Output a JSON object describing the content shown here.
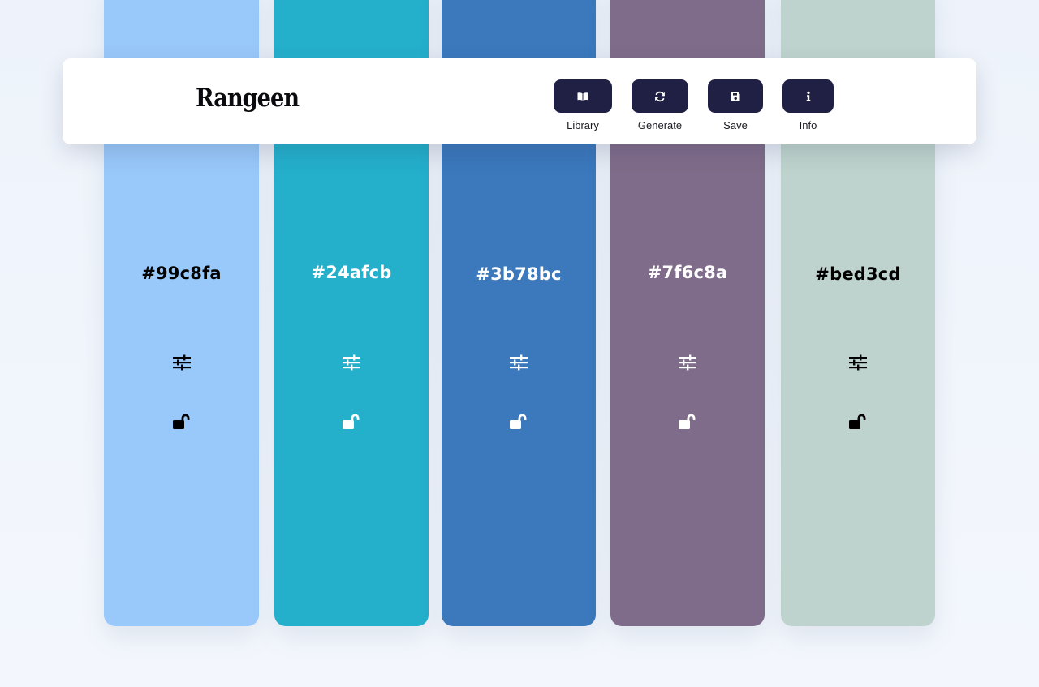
{
  "app": {
    "logo_text": "Rangeen"
  },
  "toolbar": {
    "library_label": "Library",
    "generate_label": "Generate",
    "save_label": "Save",
    "info_label": "Info",
    "button_color": "#1f2044"
  },
  "palette": [
    {
      "hex": "#99c8fa",
      "label": "#99c8fa",
      "text_color": "#000000",
      "locked": false,
      "adjust_icon": "sliders-icon",
      "lock_icon": "unlock-icon"
    },
    {
      "hex": "#24afcb",
      "label": "#24afcb",
      "text_color": "#ffffff",
      "locked": false,
      "adjust_icon": "sliders-icon",
      "lock_icon": "unlock-icon"
    },
    {
      "hex": "#3b78bc",
      "label": "#3b78bc",
      "text_color": "#ffffff",
      "locked": false,
      "adjust_icon": "sliders-icon",
      "lock_icon": "unlock-icon"
    },
    {
      "hex": "#7f6c8a",
      "label": "#7f6c8a",
      "text_color": "#ffffff",
      "locked": false,
      "adjust_icon": "sliders-icon",
      "lock_icon": "unlock-icon"
    },
    {
      "hex": "#bed3cd",
      "label": "#bed3cd",
      "text_color": "#000000",
      "locked": false,
      "adjust_icon": "sliders-icon",
      "lock_icon": "unlock-icon"
    }
  ]
}
